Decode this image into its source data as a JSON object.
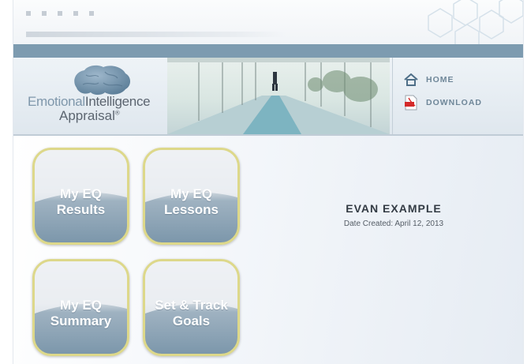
{
  "logo": {
    "line1_part1": "Emotional",
    "line1_part2": "Intelligence",
    "line2": "Appraisal",
    "mark": "®"
  },
  "nav": {
    "home_label": "HOME",
    "download_label": "DOWNLOAD",
    "home_icon": "house-icon",
    "download_icon": "pdf-icon"
  },
  "tiles": [
    {
      "line1": "My EQ",
      "line2": "Results"
    },
    {
      "line1": "My EQ",
      "line2": "Lessons"
    },
    {
      "line1": "My EQ",
      "line2": "Summary"
    },
    {
      "line1": "Set & Track",
      "line2": "Goals"
    }
  ],
  "user": {
    "name": "EVAN EXAMPLE",
    "date_created": "Date Created: April 12, 2013"
  },
  "colors": {
    "accent_bar": "#7d9bb0",
    "tile_border": "#ddd88a",
    "nav_text": "#6f8799"
  }
}
